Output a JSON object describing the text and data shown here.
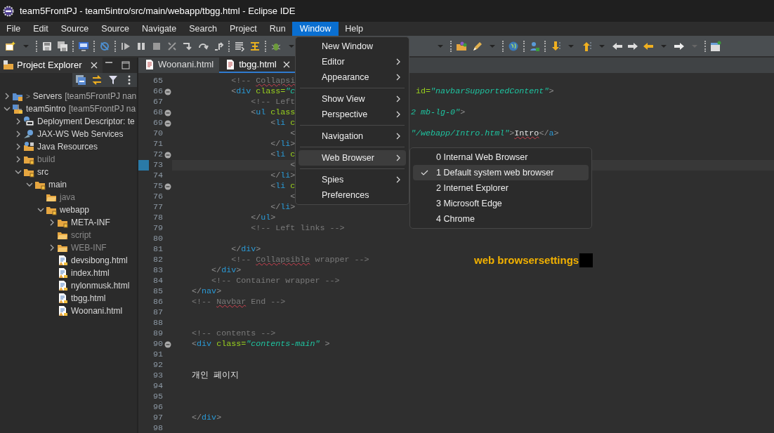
{
  "window": {
    "title": "team5FrontPJ - team5intro/src/main/webapp/tbgg.html - Eclipse IDE"
  },
  "menu_bar": [
    {
      "label": "File",
      "selected": false
    },
    {
      "label": "Edit",
      "selected": false
    },
    {
      "label": "Source",
      "selected": false
    },
    {
      "label": "Source",
      "selected": false
    },
    {
      "label": "Navigate",
      "selected": false
    },
    {
      "label": "Search",
      "selected": false
    },
    {
      "label": "Project",
      "selected": false
    },
    {
      "label": "Run",
      "selected": false
    },
    {
      "label": "Window",
      "selected": true
    },
    {
      "label": "Help",
      "selected": false
    }
  ],
  "explorer": {
    "tab": {
      "label": "Project Explorer",
      "selected": true
    },
    "tree": [
      {
        "kind": "server",
        "decoration": ">",
        "label": "Servers",
        "qualifier": "[team5FrontPJ nan",
        "expanded": false,
        "dimmed": false
      },
      {
        "kind": "project",
        "label": "team5intro",
        "qualifier": "[team5FrontPJ na",
        "expanded": true,
        "dimmed": false,
        "children": [
          {
            "kind": "descriptor",
            "label": "Deployment Descriptor: te",
            "expanded": false,
            "dimmed": false
          },
          {
            "kind": "webservice",
            "label": "JAX-WS Web Services",
            "expanded": false,
            "dimmed": false
          },
          {
            "kind": "resources",
            "label": "Java Resources",
            "expanded": false,
            "dimmed": false
          },
          {
            "kind": "folder",
            "label": "build",
            "expanded": false,
            "dimmed": true
          },
          {
            "kind": "folder",
            "label": "src",
            "expanded": true,
            "dimmed": false,
            "children": [
              {
                "kind": "folder",
                "label": "main",
                "expanded": true,
                "dimmed": false,
                "children": [
                  {
                    "kind": "plain-folder",
                    "label": "java",
                    "dimmed": true
                  },
                  {
                    "kind": "folder",
                    "label": "webapp",
                    "expanded": true,
                    "dimmed": false,
                    "children": [
                      {
                        "kind": "folder",
                        "label": "META-INF",
                        "expanded": false,
                        "dimmed": false
                      },
                      {
                        "kind": "plain-folder",
                        "label": "script",
                        "dimmed": true
                      },
                      {
                        "kind": "plain-folder",
                        "label": "WEB-INF",
                        "expanded": false,
                        "dimmed": true
                      },
                      {
                        "kind": "file",
                        "label": "devsibong.html",
                        "dimmed": false
                      },
                      {
                        "kind": "file",
                        "label": "index.html",
                        "dimmed": false
                      },
                      {
                        "kind": "file",
                        "label": "nylonmusk.html",
                        "dimmed": false
                      },
                      {
                        "kind": "file",
                        "label": "tbgg.html",
                        "dimmed": false
                      },
                      {
                        "kind": "file",
                        "label": "Woonani.html",
                        "dimmed": false
                      }
                    ]
                  }
                ]
              }
            ]
          }
        ]
      }
    ]
  },
  "editor_tabs": [
    {
      "label": "Woonani.html",
      "selected": false
    },
    {
      "label": "tbgg.html",
      "selected": true
    }
  ],
  "code_lines": [
    {
      "number": "65",
      "foldable": false,
      "current": false,
      "left": [
        {
          "kind": "comment",
          "text": "            <!-- "
        },
        {
          "kind": "comment",
          "text": "Collapsi",
          "misspelled": true
        }
      ]
    },
    {
      "number": "66",
      "foldable": true,
      "current": false,
      "left": [
        {
          "kind": "punct",
          "text": "            <"
        },
        {
          "kind": "tag",
          "text": "div"
        },
        {
          "kind": "attr",
          "text": " class="
        },
        {
          "kind": "string",
          "text": "\"c"
        }
      ],
      "right": [
        {
          "kind": "attr",
          "text": " id="
        },
        {
          "kind": "string",
          "text": "\"navbarSupportedContent\""
        },
        {
          "kind": "punct",
          "text": ">"
        }
      ]
    },
    {
      "number": "67",
      "foldable": false,
      "current": false,
      "left": [
        {
          "kind": "comment",
          "text": "                <!-- Left"
        }
      ]
    },
    {
      "number": "68",
      "foldable": true,
      "current": false,
      "left": [
        {
          "kind": "punct",
          "text": "                <"
        },
        {
          "kind": "tag",
          "text": "ul"
        },
        {
          "kind": "attr",
          "text": " class"
        }
      ],
      "right": [
        {
          "kind": "string",
          "text": "2 mb-lg-0\""
        },
        {
          "kind": "punct",
          "text": ">"
        }
      ]
    },
    {
      "number": "69",
      "foldable": true,
      "current": false,
      "left": [
        {
          "kind": "punct",
          "text": "                    <"
        },
        {
          "kind": "tag",
          "text": "li"
        },
        {
          "kind": "attr",
          "text": " c"
        }
      ]
    },
    {
      "number": "70",
      "foldable": false,
      "current": false,
      "left": [
        {
          "kind": "punct",
          "text": "                        <"
        }
      ],
      "right": [
        {
          "kind": "string",
          "text": "\"/webapp/Intro.html\""
        },
        {
          "kind": "punct",
          "text": ">"
        },
        {
          "kind": "text",
          "text": "Intro",
          "misspelled": true
        },
        {
          "kind": "punct",
          "text": "</"
        },
        {
          "kind": "tag",
          "text": "a"
        },
        {
          "kind": "punct",
          "text": ">"
        }
      ]
    },
    {
      "number": "71",
      "foldable": false,
      "current": false,
      "left": [
        {
          "kind": "punct",
          "text": "                    </"
        },
        {
          "kind": "tag",
          "text": "li"
        },
        {
          "kind": "punct",
          "text": ">"
        }
      ]
    },
    {
      "number": "72",
      "foldable": true,
      "current": false,
      "left": [
        {
          "kind": "punct",
          "text": "                    <"
        },
        {
          "kind": "tag",
          "text": "li"
        },
        {
          "kind": "attr",
          "text": " c"
        }
      ]
    },
    {
      "number": "73",
      "foldable": false,
      "current": true,
      "left": [
        {
          "kind": "punct",
          "text": "                        <"
        }
      ]
    },
    {
      "number": "74",
      "foldable": false,
      "current": false,
      "left": [
        {
          "kind": "punct",
          "text": "                    </"
        },
        {
          "kind": "tag",
          "text": "li"
        },
        {
          "kind": "punct",
          "text": ">"
        }
      ]
    },
    {
      "number": "75",
      "foldable": true,
      "current": false,
      "left": [
        {
          "kind": "punct",
          "text": "                    <"
        },
        {
          "kind": "tag",
          "text": "li"
        },
        {
          "kind": "attr",
          "text": " c"
        }
      ]
    },
    {
      "number": "76",
      "foldable": false,
      "current": false,
      "left": [
        {
          "kind": "punct",
          "text": "                        <"
        }
      ]
    },
    {
      "number": "77",
      "foldable": false,
      "current": false,
      "left": [
        {
          "kind": "punct",
          "text": "                    </"
        },
        {
          "kind": "tag",
          "text": "li"
        },
        {
          "kind": "punct",
          "text": ">"
        }
      ]
    },
    {
      "number": "78",
      "foldable": false,
      "current": false,
      "left": [
        {
          "kind": "punct",
          "text": "                </"
        },
        {
          "kind": "tag",
          "text": "ul"
        },
        {
          "kind": "punct",
          "text": ">"
        }
      ]
    },
    {
      "number": "79",
      "foldable": false,
      "current": false,
      "left": [
        {
          "kind": "comment",
          "text": "                <!-- Left links -->"
        }
      ]
    },
    {
      "number": "80",
      "foldable": false,
      "current": false
    },
    {
      "number": "81",
      "foldable": false,
      "current": false,
      "left": [
        {
          "kind": "punct",
          "text": "            </"
        },
        {
          "kind": "tag",
          "text": "div"
        },
        {
          "kind": "punct",
          "text": ">"
        }
      ]
    },
    {
      "number": "82",
      "foldable": false,
      "current": false,
      "left": [
        {
          "kind": "comment",
          "text": "            <!-- "
        },
        {
          "kind": "comment",
          "text": "Collapsible",
          "misspelled": true
        },
        {
          "kind": "comment",
          "text": " wrapper -->"
        }
      ]
    },
    {
      "number": "83",
      "foldable": false,
      "current": false,
      "left": [
        {
          "kind": "punct",
          "text": "        </"
        },
        {
          "kind": "tag",
          "text": "div"
        },
        {
          "kind": "punct",
          "text": ">"
        }
      ]
    },
    {
      "number": "84",
      "foldable": false,
      "current": false,
      "left": [
        {
          "kind": "comment",
          "text": "        <!-- Container wrapper -->"
        }
      ]
    },
    {
      "number": "85",
      "foldable": false,
      "current": false,
      "left": [
        {
          "kind": "punct",
          "text": "    </"
        },
        {
          "kind": "tag",
          "text": "nav"
        },
        {
          "kind": "punct",
          "text": ">"
        }
      ]
    },
    {
      "number": "86",
      "foldable": false,
      "current": false,
      "left": [
        {
          "kind": "comment",
          "text": "    <!-- "
        },
        {
          "kind": "comment",
          "text": "Navbar",
          "misspelled": true
        },
        {
          "kind": "comment",
          "text": " End -->"
        }
      ]
    },
    {
      "number": "87",
      "foldable": false,
      "current": false
    },
    {
      "number": "88",
      "foldable": false,
      "current": false
    },
    {
      "number": "89",
      "foldable": false,
      "current": false,
      "left": [
        {
          "kind": "comment",
          "text": "    <!-- contents -->"
        }
      ]
    },
    {
      "number": "90",
      "foldable": true,
      "current": false,
      "left": [
        {
          "kind": "punct",
          "text": "    <"
        },
        {
          "kind": "tag",
          "text": "div"
        },
        {
          "kind": "attr",
          "text": " class="
        },
        {
          "kind": "string",
          "text": "\"contents-main\""
        },
        {
          "kind": "punct",
          "text": " >"
        }
      ]
    },
    {
      "number": "91",
      "foldable": false,
      "current": false
    },
    {
      "number": "92",
      "foldable": false,
      "current": false
    },
    {
      "number": "93",
      "foldable": false,
      "current": false,
      "left": [
        {
          "kind": "text",
          "text": "    개인 페이지"
        }
      ]
    },
    {
      "number": "94",
      "foldable": false,
      "current": false
    },
    {
      "number": "95",
      "foldable": false,
      "current": false
    },
    {
      "number": "96",
      "foldable": false,
      "current": false
    },
    {
      "number": "97",
      "foldable": false,
      "current": false,
      "left": [
        {
          "kind": "punct",
          "text": "    </"
        },
        {
          "kind": "tag",
          "text": "div"
        },
        {
          "kind": "punct",
          "text": ">"
        }
      ]
    },
    {
      "number": "98",
      "foldable": false,
      "current": false
    }
  ],
  "overlay_note": {
    "text": "web browsersettings"
  },
  "window_menu": [
    {
      "kind": "item",
      "label": "New Window",
      "submenu": false,
      "highlighted": false
    },
    {
      "kind": "item",
      "label": "Editor",
      "submenu": true,
      "highlighted": false
    },
    {
      "kind": "item",
      "label": "Appearance",
      "submenu": true,
      "highlighted": false
    },
    {
      "kind": "separator"
    },
    {
      "kind": "item",
      "label": "Show View",
      "submenu": true,
      "highlighted": false
    },
    {
      "kind": "item",
      "label": "Perspective",
      "submenu": true,
      "highlighted": false
    },
    {
      "kind": "separator"
    },
    {
      "kind": "item",
      "label": "Navigation",
      "submenu": true,
      "highlighted": false
    },
    {
      "kind": "separator"
    },
    {
      "kind": "item",
      "label": "Web Browser",
      "submenu": true,
      "highlighted": true
    },
    {
      "kind": "separator"
    },
    {
      "kind": "item",
      "label": "Spies",
      "submenu": true,
      "highlighted": false
    },
    {
      "kind": "item",
      "label": "Preferences",
      "submenu": false,
      "highlighted": false
    }
  ],
  "web_browser_submenu": [
    {
      "label": "0 Internal Web Browser",
      "checked": false,
      "highlighted": false
    },
    {
      "label": "1 Default system web browser",
      "checked": true,
      "highlighted": true
    },
    {
      "label": "2 Internet Explorer",
      "checked": false,
      "highlighted": false
    },
    {
      "label": "3 Microsoft Edge",
      "checked": false,
      "highlighted": false
    },
    {
      "label": "4 Chrome",
      "checked": false,
      "highlighted": false
    }
  ]
}
